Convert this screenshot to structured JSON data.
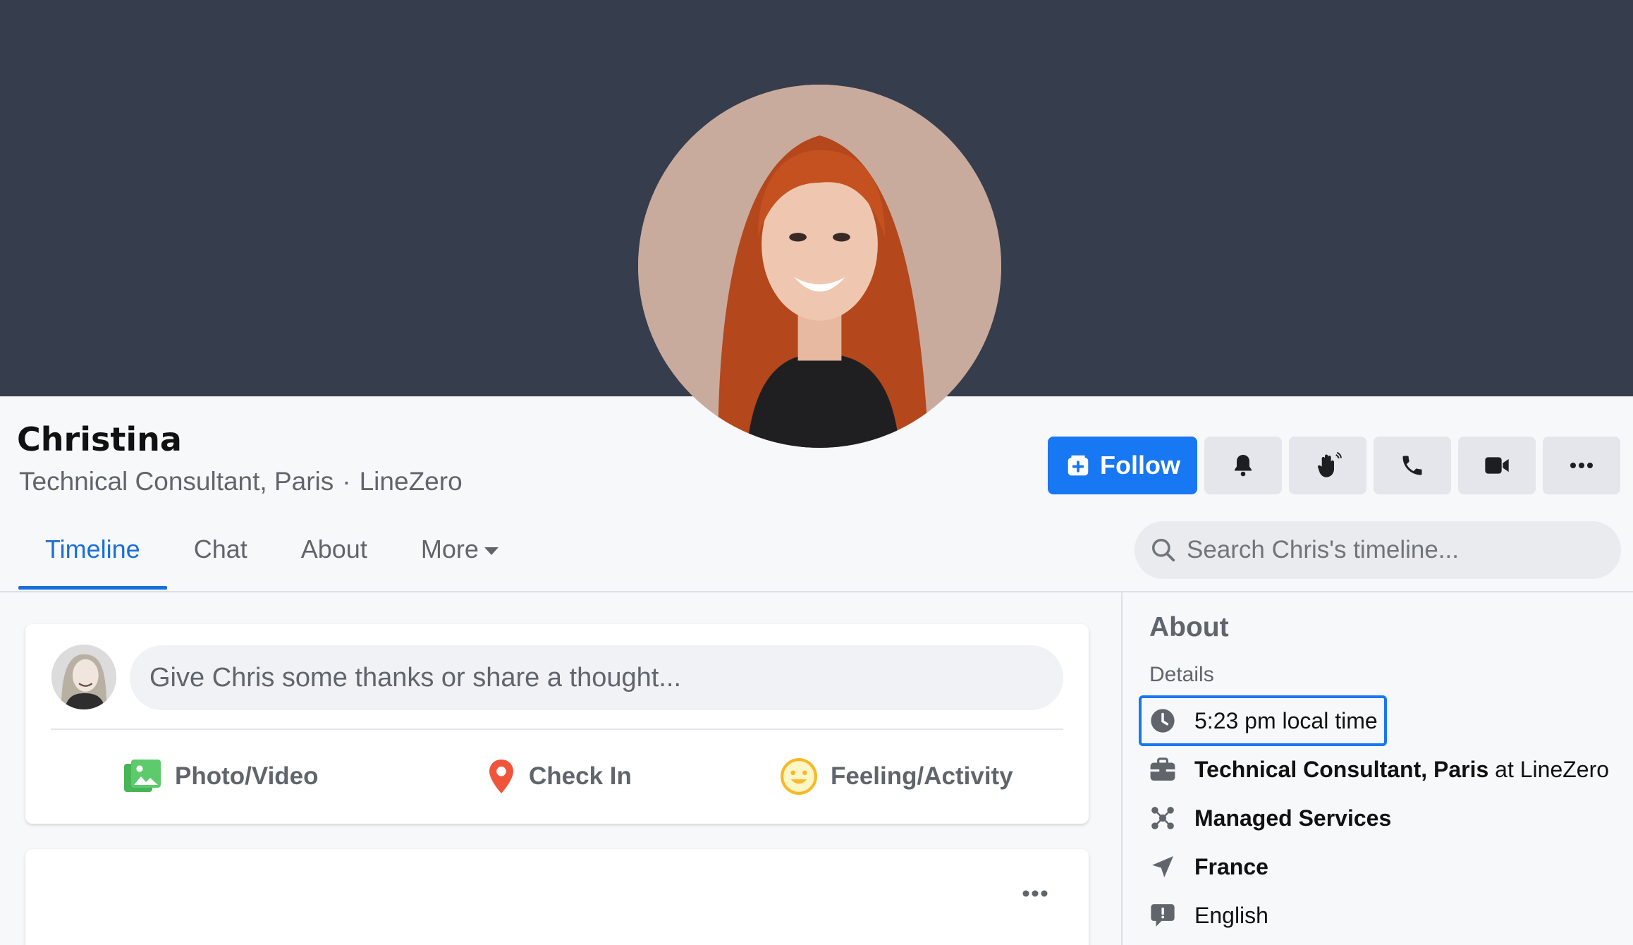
{
  "profile": {
    "name": "Christina",
    "role": "Technical Consultant, Paris",
    "separator": "·",
    "company": "LineZero"
  },
  "actions": {
    "follow_label": "Follow",
    "icons": [
      "bell-icon",
      "wave-icon",
      "phone-icon",
      "video-icon",
      "more-icon"
    ]
  },
  "tabs": [
    {
      "label": "Timeline",
      "active": true
    },
    {
      "label": "Chat",
      "active": false
    },
    {
      "label": "About",
      "active": false
    },
    {
      "label": "More",
      "active": false
    }
  ],
  "search": {
    "placeholder": "Search Chris's timeline..."
  },
  "composer": {
    "placeholder": "Give Chris some thanks or share a thought...",
    "actions": [
      {
        "label": "Photo/Video",
        "icon": "photo-icon"
      },
      {
        "label": "Check In",
        "icon": "location-pin-icon"
      },
      {
        "label": "Feeling/Activity",
        "icon": "smiley-icon"
      }
    ]
  },
  "about": {
    "title": "About",
    "details_label": "Details",
    "local_time": "5:23 pm local time",
    "job_title": "Technical Consultant, Paris",
    "job_connector": "at",
    "job_company": "LineZero",
    "department": "Managed Services",
    "country": "France",
    "language": "English"
  },
  "colors": {
    "cover": "#363d4d",
    "accent": "#1877f2",
    "background": "#f7f8fa"
  }
}
